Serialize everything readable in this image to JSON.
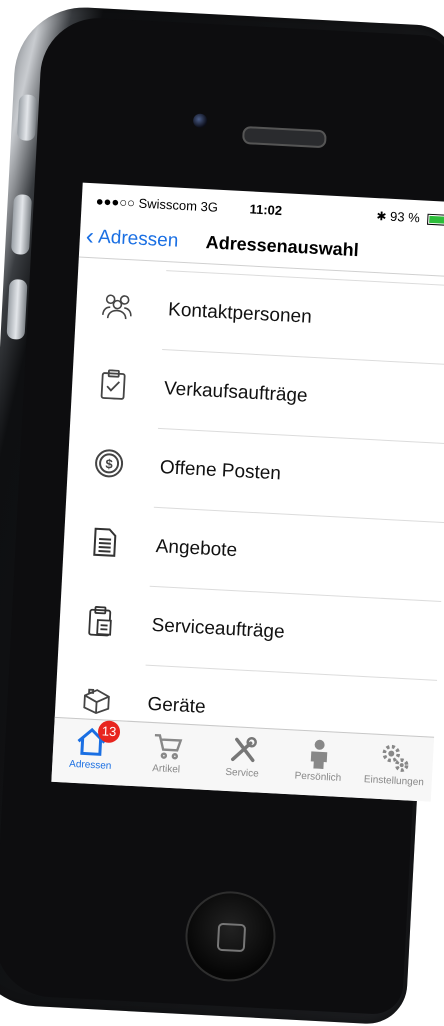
{
  "status_bar": {
    "carrier": "●●●○○ Swisscom  3G",
    "time": "11:02",
    "battery_text": "93 %",
    "battery_level": 0.93
  },
  "nav": {
    "back_label": "Adressen",
    "title": "Adressenauswahl"
  },
  "list": {
    "items": [
      {
        "label": "Kontaktpersonen",
        "icon": "people-group-icon"
      },
      {
        "label": "Verkaufsaufträge",
        "icon": "clipboard-check-icon"
      },
      {
        "label": "Offene Posten",
        "icon": "dollar-coin-icon"
      },
      {
        "label": "Angebote",
        "icon": "document-icon"
      },
      {
        "label": "Serviceaufträge",
        "icon": "clipboard-doc-icon"
      },
      {
        "label": "Geräte",
        "icon": "device-box-icon"
      }
    ]
  },
  "tabbar": {
    "tabs": [
      {
        "label": "Adressen",
        "icon": "home-icon",
        "active": true,
        "badge": "13"
      },
      {
        "label": "Artikel",
        "icon": "cart-icon"
      },
      {
        "label": "Service",
        "icon": "tools-icon"
      },
      {
        "label": "Persönlich",
        "icon": "person-icon"
      },
      {
        "label": "Einstellungen",
        "icon": "gears-icon"
      }
    ]
  },
  "colors": {
    "accent": "#1a6fe3",
    "badge": "#e8251f",
    "battery": "#2dbd3a"
  }
}
